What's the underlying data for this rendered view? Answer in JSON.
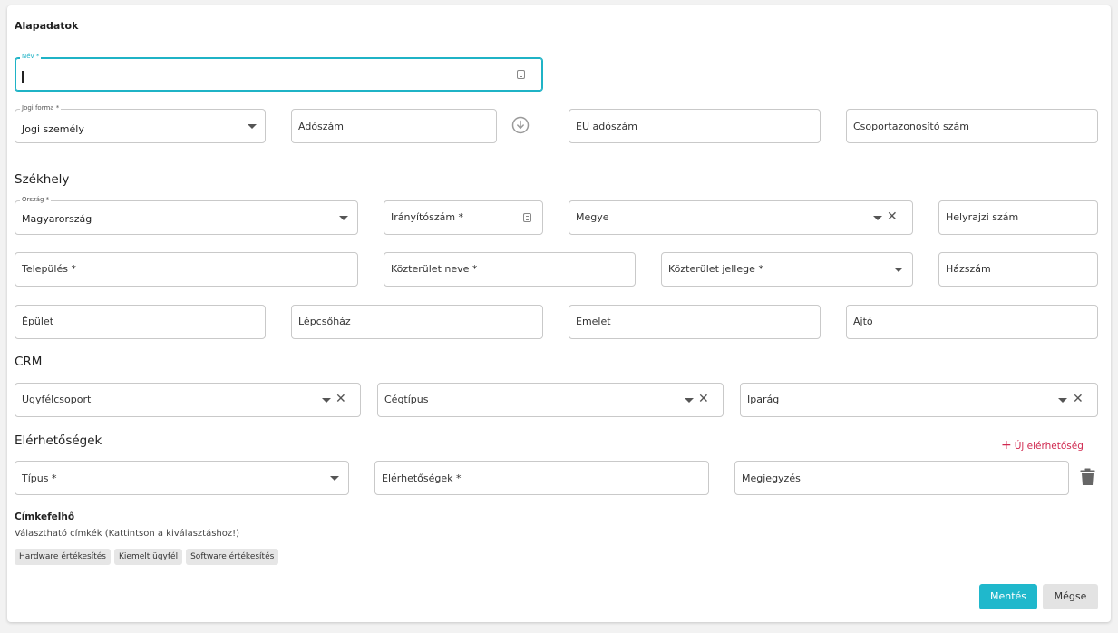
{
  "title": "Alapadatok",
  "name_field": {
    "label": "Név *",
    "value": ""
  },
  "legal_form": {
    "label": "Jogi forma *",
    "value": "Jogi személy"
  },
  "tax_number": {
    "placeholder": "Adószám"
  },
  "eu_tax_number": {
    "placeholder": "EU adószám"
  },
  "group_id": {
    "placeholder": "Csoportazonosító szám"
  },
  "seat": {
    "heading": "Székhely",
    "country": {
      "label": "Ország *",
      "value": "Magyarország"
    },
    "zip": "Irányítószám *",
    "county": "Megye",
    "lot_number": "Helyrajzi szám",
    "city": "Település *",
    "street_name": "Közterület neve *",
    "street_type": "Közterület jellege *",
    "house_number": "Házszám",
    "building": "Épület",
    "staircase": "Lépcsőház",
    "floor": "Emelet",
    "door": "Ajtó"
  },
  "crm": {
    "heading": "CRM",
    "client_group": "Ugyfélcsoport",
    "company_type": "Cégtípus",
    "industry": "Iparág"
  },
  "contacts": {
    "heading": "Elérhetőségek",
    "add_label": "Új elérhetőség",
    "type": "Típus *",
    "contacts": "Elérhetőségek *",
    "note": "Megjegyzés"
  },
  "tags": {
    "heading": "Címkefelhő",
    "hint": "Választható címkék (Kattintson a kiválasztáshoz!)",
    "items": [
      "Hardware értékesítés",
      "Kiemelt ügyfél",
      "Software értékesítés"
    ]
  },
  "actions": {
    "save": "Mentés",
    "cancel": "Mégse"
  },
  "colors": {
    "accent": "#1fb8cc",
    "danger": "#d0284f"
  }
}
